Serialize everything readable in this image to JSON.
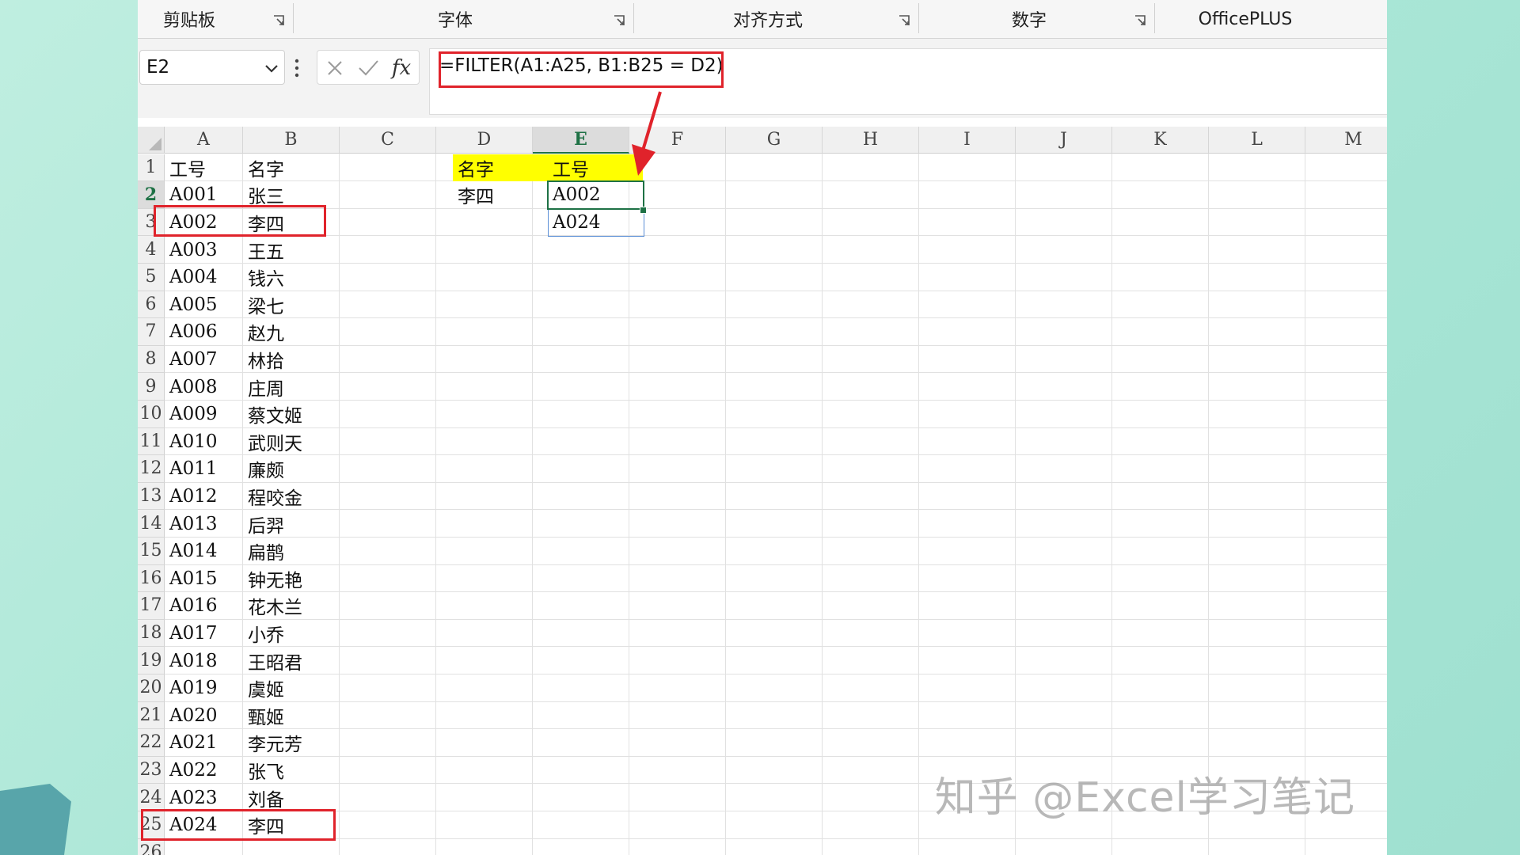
{
  "ribbon": {
    "groups": [
      "剪贴板",
      "字体",
      "对齐方式",
      "数字",
      "OfficePLUS"
    ]
  },
  "formula_bar": {
    "name_box": "E2",
    "formula": "=FILTER(A1:A25, B1:B25 = D2)"
  },
  "sheet": {
    "columns": [
      "A",
      "B",
      "C",
      "D",
      "E",
      "F",
      "G",
      "H",
      "I",
      "J",
      "K",
      "L",
      "M"
    ],
    "selected_column": "E",
    "selected_row": 2,
    "rows": [
      {
        "n": "1",
        "a": "工号",
        "b": "名字"
      },
      {
        "n": "2",
        "a": "A001",
        "b": "张三"
      },
      {
        "n": "3",
        "a": "A002",
        "b": "李四"
      },
      {
        "n": "4",
        "a": "A003",
        "b": "王五"
      },
      {
        "n": "5",
        "a": "A004",
        "b": "钱六"
      },
      {
        "n": "6",
        "a": "A005",
        "b": "梁七"
      },
      {
        "n": "7",
        "a": "A006",
        "b": "赵九"
      },
      {
        "n": "8",
        "a": "A007",
        "b": "林拾"
      },
      {
        "n": "9",
        "a": "A008",
        "b": "庄周"
      },
      {
        "n": "10",
        "a": "A009",
        "b": "蔡文姬"
      },
      {
        "n": "11",
        "a": "A010",
        "b": "武则天"
      },
      {
        "n": "12",
        "a": "A011",
        "b": "廉颇"
      },
      {
        "n": "13",
        "a": "A012",
        "b": "程咬金"
      },
      {
        "n": "14",
        "a": "A013",
        "b": "后羿"
      },
      {
        "n": "15",
        "a": "A014",
        "b": "扁鹊"
      },
      {
        "n": "16",
        "a": "A015",
        "b": "钟无艳"
      },
      {
        "n": "17",
        "a": "A016",
        "b": "花木兰"
      },
      {
        "n": "18",
        "a": "A017",
        "b": "小乔"
      },
      {
        "n": "19",
        "a": "A018",
        "b": "王昭君"
      },
      {
        "n": "20",
        "a": "A019",
        "b": "虞姬"
      },
      {
        "n": "21",
        "a": "A020",
        "b": "甄姬"
      },
      {
        "n": "22",
        "a": "A021",
        "b": "李元芳"
      },
      {
        "n": "23",
        "a": "A022",
        "b": "张飞"
      },
      {
        "n": "24",
        "a": "A023",
        "b": "刘备"
      },
      {
        "n": "25",
        "a": "A024",
        "b": "李四"
      },
      {
        "n": "26",
        "a": "",
        "b": ""
      }
    ],
    "lookup": {
      "d1": "名字",
      "e1": "工号",
      "d2": "李四",
      "e2": "A002",
      "e3": "A024"
    }
  },
  "colors": {
    "header_highlight": "#ffff00",
    "annotation_red": "#e0232b",
    "selection_green": "#1e7145"
  },
  "watermark": "知乎 @Excel学习笔记"
}
